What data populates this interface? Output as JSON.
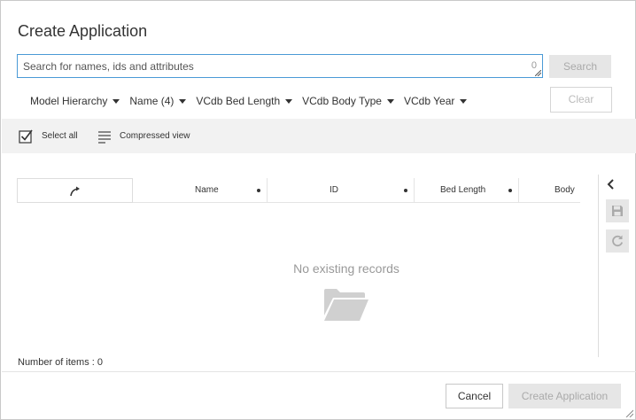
{
  "dialog": {
    "title": "Create Application"
  },
  "search": {
    "placeholder": "Search for names, ids and attributes",
    "char_count": "0",
    "search_button": "Search",
    "clear_button": "Clear"
  },
  "filters": [
    {
      "label": "Model Hierarchy"
    },
    {
      "label": "Name (4)"
    },
    {
      "label": "VCdb Bed Length"
    },
    {
      "label": "VCdb Body Type"
    },
    {
      "label": "VCdb Year"
    }
  ],
  "toolbar": {
    "select_all": "Select all",
    "compressed_view": "Compressed view"
  },
  "table": {
    "columns": [
      "Name",
      "ID",
      "Bed Length",
      "Body"
    ],
    "empty_message": "No existing records"
  },
  "side_panel": {
    "collapse_icon": "chevron-left-icon",
    "save_icon": "save-icon",
    "refresh_icon": "refresh-icon"
  },
  "footer": {
    "items_count": "Number of items : 0",
    "cancel_button": "Cancel",
    "create_button": "Create Application"
  },
  "colors": {
    "accent_border": "#4a9ad6",
    "disabled_bg": "#e6e6e6",
    "toolbar_bg": "#f2f2f2"
  }
}
